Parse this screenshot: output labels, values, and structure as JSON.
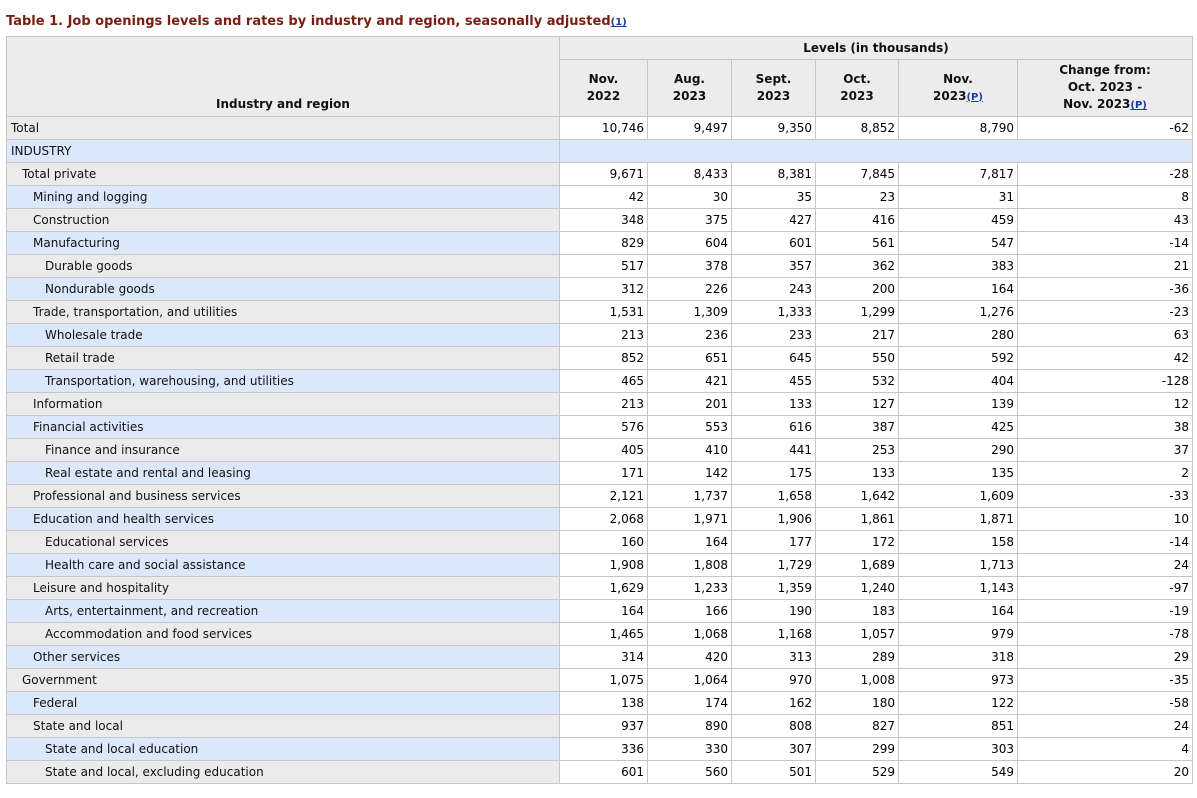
{
  "caption": {
    "text": "Table 1. Job openings levels and rates by industry and region, seasonally adjusted",
    "footnote": "(1)"
  },
  "header": {
    "industry_col": "Industry and region",
    "levels_group": "Levels (in thousands)",
    "columns": [
      {
        "line1": "Nov.",
        "line2": "2022",
        "mark": ""
      },
      {
        "line1": "Aug.",
        "line2": "2023",
        "mark": ""
      },
      {
        "line1": "Sept.",
        "line2": "2023",
        "mark": ""
      },
      {
        "line1": "Oct.",
        "line2": "2023",
        "mark": ""
      },
      {
        "line1": "Nov.",
        "line2": "2023",
        "mark": "(P)"
      }
    ],
    "change": {
      "line1": "Change from:",
      "line2": "Oct. 2023 -",
      "line3": "Nov. 2023",
      "mark": "(P)"
    }
  },
  "rows": [
    {
      "label": "Total",
      "level": 0,
      "values": [
        "10,746",
        "9,497",
        "9,350",
        "8,852",
        "8,790",
        "-62"
      ]
    },
    {
      "label": "INDUSTRY",
      "level": 0,
      "section": true,
      "values": []
    },
    {
      "label": "Total private",
      "level": 1,
      "values": [
        "9,671",
        "8,433",
        "8,381",
        "7,845",
        "7,817",
        "-28"
      ]
    },
    {
      "label": "Mining and logging",
      "level": 2,
      "values": [
        "42",
        "30",
        "35",
        "23",
        "31",
        "8"
      ]
    },
    {
      "label": "Construction",
      "level": 2,
      "values": [
        "348",
        "375",
        "427",
        "416",
        "459",
        "43"
      ]
    },
    {
      "label": "Manufacturing",
      "level": 2,
      "values": [
        "829",
        "604",
        "601",
        "561",
        "547",
        "-14"
      ]
    },
    {
      "label": "Durable goods",
      "level": 3,
      "values": [
        "517",
        "378",
        "357",
        "362",
        "383",
        "21"
      ]
    },
    {
      "label": "Nondurable goods",
      "level": 3,
      "values": [
        "312",
        "226",
        "243",
        "200",
        "164",
        "-36"
      ]
    },
    {
      "label": "Trade, transportation, and utilities",
      "level": 2,
      "values": [
        "1,531",
        "1,309",
        "1,333",
        "1,299",
        "1,276",
        "-23"
      ]
    },
    {
      "label": "Wholesale trade",
      "level": 3,
      "values": [
        "213",
        "236",
        "233",
        "217",
        "280",
        "63"
      ]
    },
    {
      "label": "Retail trade",
      "level": 3,
      "values": [
        "852",
        "651",
        "645",
        "550",
        "592",
        "42"
      ]
    },
    {
      "label": "Transportation, warehousing, and utilities",
      "level": 3,
      "values": [
        "465",
        "421",
        "455",
        "532",
        "404",
        "-128"
      ]
    },
    {
      "label": "Information",
      "level": 2,
      "values": [
        "213",
        "201",
        "133",
        "127",
        "139",
        "12"
      ]
    },
    {
      "label": "Financial activities",
      "level": 2,
      "values": [
        "576",
        "553",
        "616",
        "387",
        "425",
        "38"
      ]
    },
    {
      "label": "Finance and insurance",
      "level": 3,
      "values": [
        "405",
        "410",
        "441",
        "253",
        "290",
        "37"
      ]
    },
    {
      "label": "Real estate and rental and leasing",
      "level": 3,
      "values": [
        "171",
        "142",
        "175",
        "133",
        "135",
        "2"
      ]
    },
    {
      "label": "Professional and business services",
      "level": 2,
      "values": [
        "2,121",
        "1,737",
        "1,658",
        "1,642",
        "1,609",
        "-33"
      ]
    },
    {
      "label": "Education and health services",
      "level": 2,
      "values": [
        "2,068",
        "1,971",
        "1,906",
        "1,861",
        "1,871",
        "10"
      ]
    },
    {
      "label": "Educational services",
      "level": 3,
      "values": [
        "160",
        "164",
        "177",
        "172",
        "158",
        "-14"
      ]
    },
    {
      "label": "Health care and social assistance",
      "level": 3,
      "values": [
        "1,908",
        "1,808",
        "1,729",
        "1,689",
        "1,713",
        "24"
      ]
    },
    {
      "label": "Leisure and hospitality",
      "level": 2,
      "values": [
        "1,629",
        "1,233",
        "1,359",
        "1,240",
        "1,143",
        "-97"
      ]
    },
    {
      "label": "Arts, entertainment, and recreation",
      "level": 3,
      "values": [
        "164",
        "166",
        "190",
        "183",
        "164",
        "-19"
      ]
    },
    {
      "label": "Accommodation and food services",
      "level": 3,
      "values": [
        "1,465",
        "1,068",
        "1,168",
        "1,057",
        "979",
        "-78"
      ]
    },
    {
      "label": "Other services",
      "level": 2,
      "values": [
        "314",
        "420",
        "313",
        "289",
        "318",
        "29"
      ]
    },
    {
      "label": "Government",
      "level": 1,
      "values": [
        "1,075",
        "1,064",
        "970",
        "1,008",
        "973",
        "-35"
      ]
    },
    {
      "label": "Federal",
      "level": 2,
      "values": [
        "138",
        "174",
        "162",
        "180",
        "122",
        "-58"
      ]
    },
    {
      "label": "State and local",
      "level": 2,
      "values": [
        "937",
        "890",
        "808",
        "827",
        "851",
        "24"
      ]
    },
    {
      "label": "State and local education",
      "level": 3,
      "values": [
        "336",
        "330",
        "307",
        "299",
        "303",
        "4"
      ]
    },
    {
      "label": "State and local, excluding education",
      "level": 3,
      "values": [
        "601",
        "560",
        "501",
        "529",
        "549",
        "20"
      ]
    }
  ]
}
